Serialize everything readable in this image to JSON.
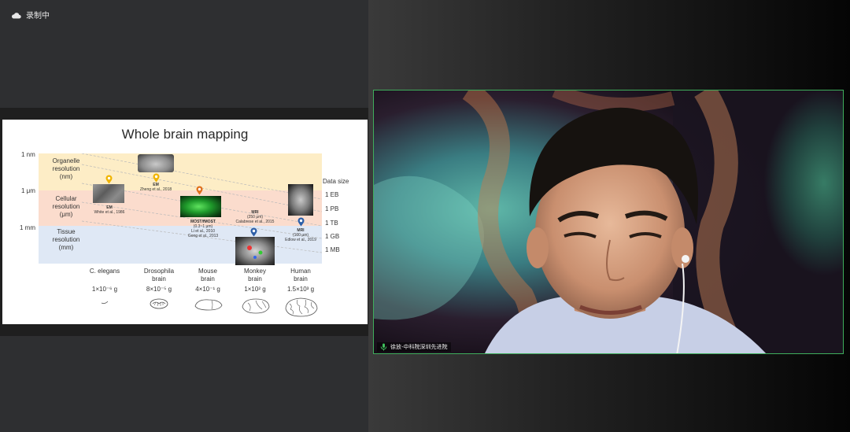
{
  "recording": {
    "label": "录制中",
    "icon": "cloud-icon"
  },
  "slide": {
    "title": "Whole brain mapping",
    "scales": [
      "1 nm",
      "1 μm",
      "1 mm"
    ],
    "bands": [
      {
        "label": "Organelle\nresolution\n(nm)"
      },
      {
        "label": "Cellular\nresolution\n(μm)"
      },
      {
        "label": "Tissue\nresolution\n(mm)"
      }
    ],
    "data_size": {
      "header": "Data size",
      "values": [
        "1 EB",
        "1 PB",
        "1 TB",
        "1 GB",
        "1 MB"
      ]
    },
    "studies": {
      "em1": {
        "method": "EM",
        "ref": "White et al., 1986"
      },
      "em2": {
        "method": "EM",
        "ref": "Zheng et al., 2018"
      },
      "most": {
        "method": "MOST/fMOST",
        "detail": "(0.3~1 μm)",
        "ref": "Li et al., 2010\nGong et al., 2013"
      },
      "mri1": {
        "method": "MRI",
        "detail": "(250 μm)",
        "ref": "Calabrese et al., 2015"
      },
      "mri2": {
        "method": "MRI",
        "detail": "(100 μm)",
        "ref": "Edlow et al., 2019"
      }
    },
    "species": [
      {
        "name": "C. elegans",
        "weight": "1×10⁻⁶ g"
      },
      {
        "name": "Drosophila\nbrain",
        "weight": "8×10⁻⁵ g"
      },
      {
        "name": "Mouse\nbrain",
        "weight": "4×10⁻¹ g"
      },
      {
        "name": "Monkey\nbrain",
        "weight": "1×10² g"
      },
      {
        "name": "Human\nbrain",
        "weight": "1.5×10³ g"
      }
    ]
  },
  "video": {
    "participant": "徐放-中科院深圳先进院",
    "mic_icon": "microphone-icon",
    "border_color": "#3fae5c"
  }
}
